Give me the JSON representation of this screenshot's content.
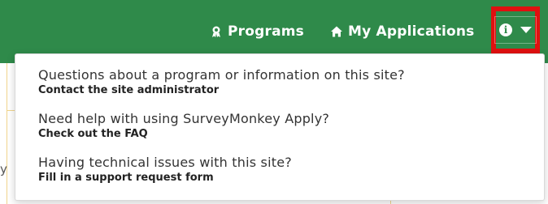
{
  "header": {
    "nav": [
      {
        "label": "Programs",
        "icon": "award-icon"
      },
      {
        "label": "My Applications",
        "icon": "home-icon"
      }
    ],
    "info_menu": {
      "icon": "info-icon",
      "caret": "caret-down-icon",
      "highlight_color": "#e01010"
    },
    "brand_color": "#2f8a4a"
  },
  "background": {
    "partial_text": "y"
  },
  "dropdown": {
    "items": [
      {
        "question": "Questions about a program or information on this site?",
        "action": "Contact the site administrator"
      },
      {
        "question": "Need help with using SurveyMonkey Apply?",
        "action": "Check out the FAQ"
      },
      {
        "question": "Having technical issues with this site?",
        "action": "Fill in a support request form"
      }
    ]
  }
}
